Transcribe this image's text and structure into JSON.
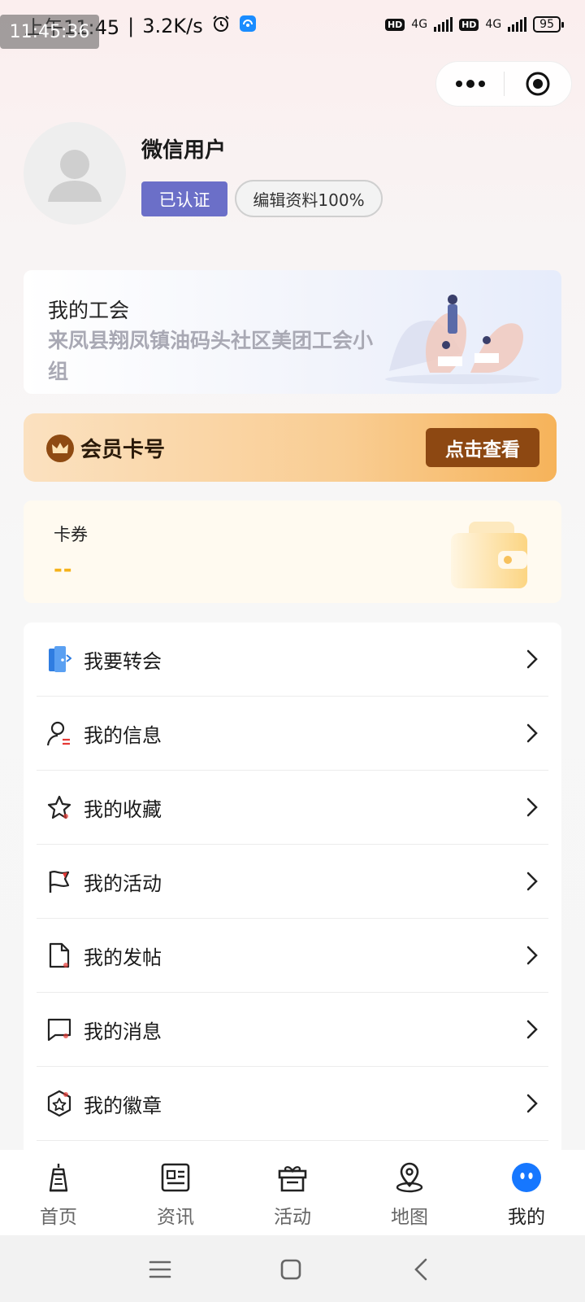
{
  "status_bar": {
    "time": "上午11:45",
    "net_speed": "3.2K/s",
    "network_type_1": "4G",
    "network_type_2": "4G",
    "hd_label": "HD",
    "battery": "95",
    "screenshot_timestamp": "11:45:36"
  },
  "profile": {
    "username": "微信用户",
    "verified_label": "已认证",
    "edit_label": "编辑资料100%"
  },
  "union": {
    "title": "我的工会",
    "name": "来凤县翔凤镇油码头社区美团工会小组"
  },
  "member": {
    "label": "会员卡号",
    "button": "点击查看",
    "colors": {
      "button_bg": "#8d4812",
      "card_end": "#f6b35a"
    }
  },
  "coupon": {
    "label": "卡券",
    "value": "--"
  },
  "menu": {
    "items": [
      {
        "label": "我要转会",
        "icon": "transfer-door-icon"
      },
      {
        "label": "我的信息",
        "icon": "user-info-icon"
      },
      {
        "label": "我的收藏",
        "icon": "star-icon"
      },
      {
        "label": "我的活动",
        "icon": "flag-icon"
      },
      {
        "label": "我的发帖",
        "icon": "document-icon"
      },
      {
        "label": "我的消息",
        "icon": "message-icon"
      },
      {
        "label": "我的徽章",
        "icon": "badge-icon"
      }
    ]
  },
  "tabbar": {
    "items": [
      {
        "label": "首页",
        "icon": "home-tower-icon",
        "active": false
      },
      {
        "label": "资讯",
        "icon": "news-icon",
        "active": false
      },
      {
        "label": "活动",
        "icon": "gift-icon",
        "active": false
      },
      {
        "label": "地图",
        "icon": "map-pin-icon",
        "active": false
      },
      {
        "label": "我的",
        "icon": "mine-face-icon",
        "active": true
      }
    ],
    "active_color": "#1677ff"
  }
}
